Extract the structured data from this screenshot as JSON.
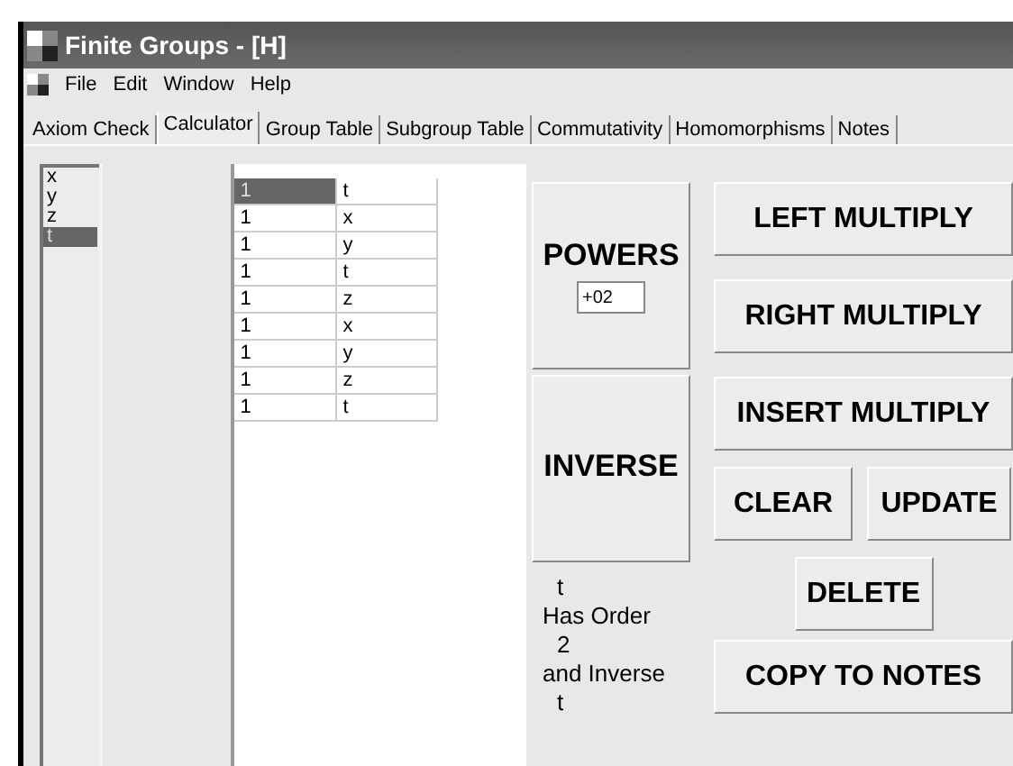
{
  "window": {
    "title": "Finite Groups - [H]"
  },
  "menu": [
    "File",
    "Edit",
    "Window",
    "Help"
  ],
  "tabs": [
    {
      "label": "Axiom Check",
      "selected": false
    },
    {
      "label": "Calculator",
      "selected": true
    },
    {
      "label": "Group Table",
      "selected": false
    },
    {
      "label": "Subgroup Table",
      "selected": false
    },
    {
      "label": "Commutativity",
      "selected": false
    },
    {
      "label": "Homomorphisms",
      "selected": false
    },
    {
      "label": "Notes",
      "selected": false
    }
  ],
  "elements": [
    {
      "label": "x",
      "selected": false
    },
    {
      "label": "y",
      "selected": false
    },
    {
      "label": "z",
      "selected": false
    },
    {
      "label": "t",
      "selected": true
    }
  ],
  "table": {
    "rows": [
      {
        "cells": [
          "1",
          "t"
        ],
        "selected": true
      },
      {
        "cells": [
          "1",
          "x"
        ],
        "selected": false
      },
      {
        "cells": [
          "1",
          "y"
        ],
        "selected": false
      },
      {
        "cells": [
          "1",
          "t"
        ],
        "selected": false
      },
      {
        "cells": [
          "1",
          "z"
        ],
        "selected": false
      },
      {
        "cells": [
          "1",
          "x"
        ],
        "selected": false
      },
      {
        "cells": [
          "1",
          "y"
        ],
        "selected": false
      },
      {
        "cells": [
          "1",
          "z"
        ],
        "selected": false
      },
      {
        "cells": [
          "1",
          "t"
        ],
        "selected": false
      }
    ]
  },
  "powers": {
    "label": "POWERS",
    "value": "+02"
  },
  "inverse_button": "INVERSE",
  "result": [
    "t",
    "Has Order",
    "2",
    "and Inverse",
    "t"
  ],
  "buttons": {
    "left": "LEFT MULTIPLY",
    "right": "RIGHT MULTIPLY",
    "insert": "INSERT MULTIPLY",
    "clear": "CLEAR",
    "update": "UPDATE",
    "delete": "DELETE",
    "copy": "COPY TO NOTES"
  }
}
